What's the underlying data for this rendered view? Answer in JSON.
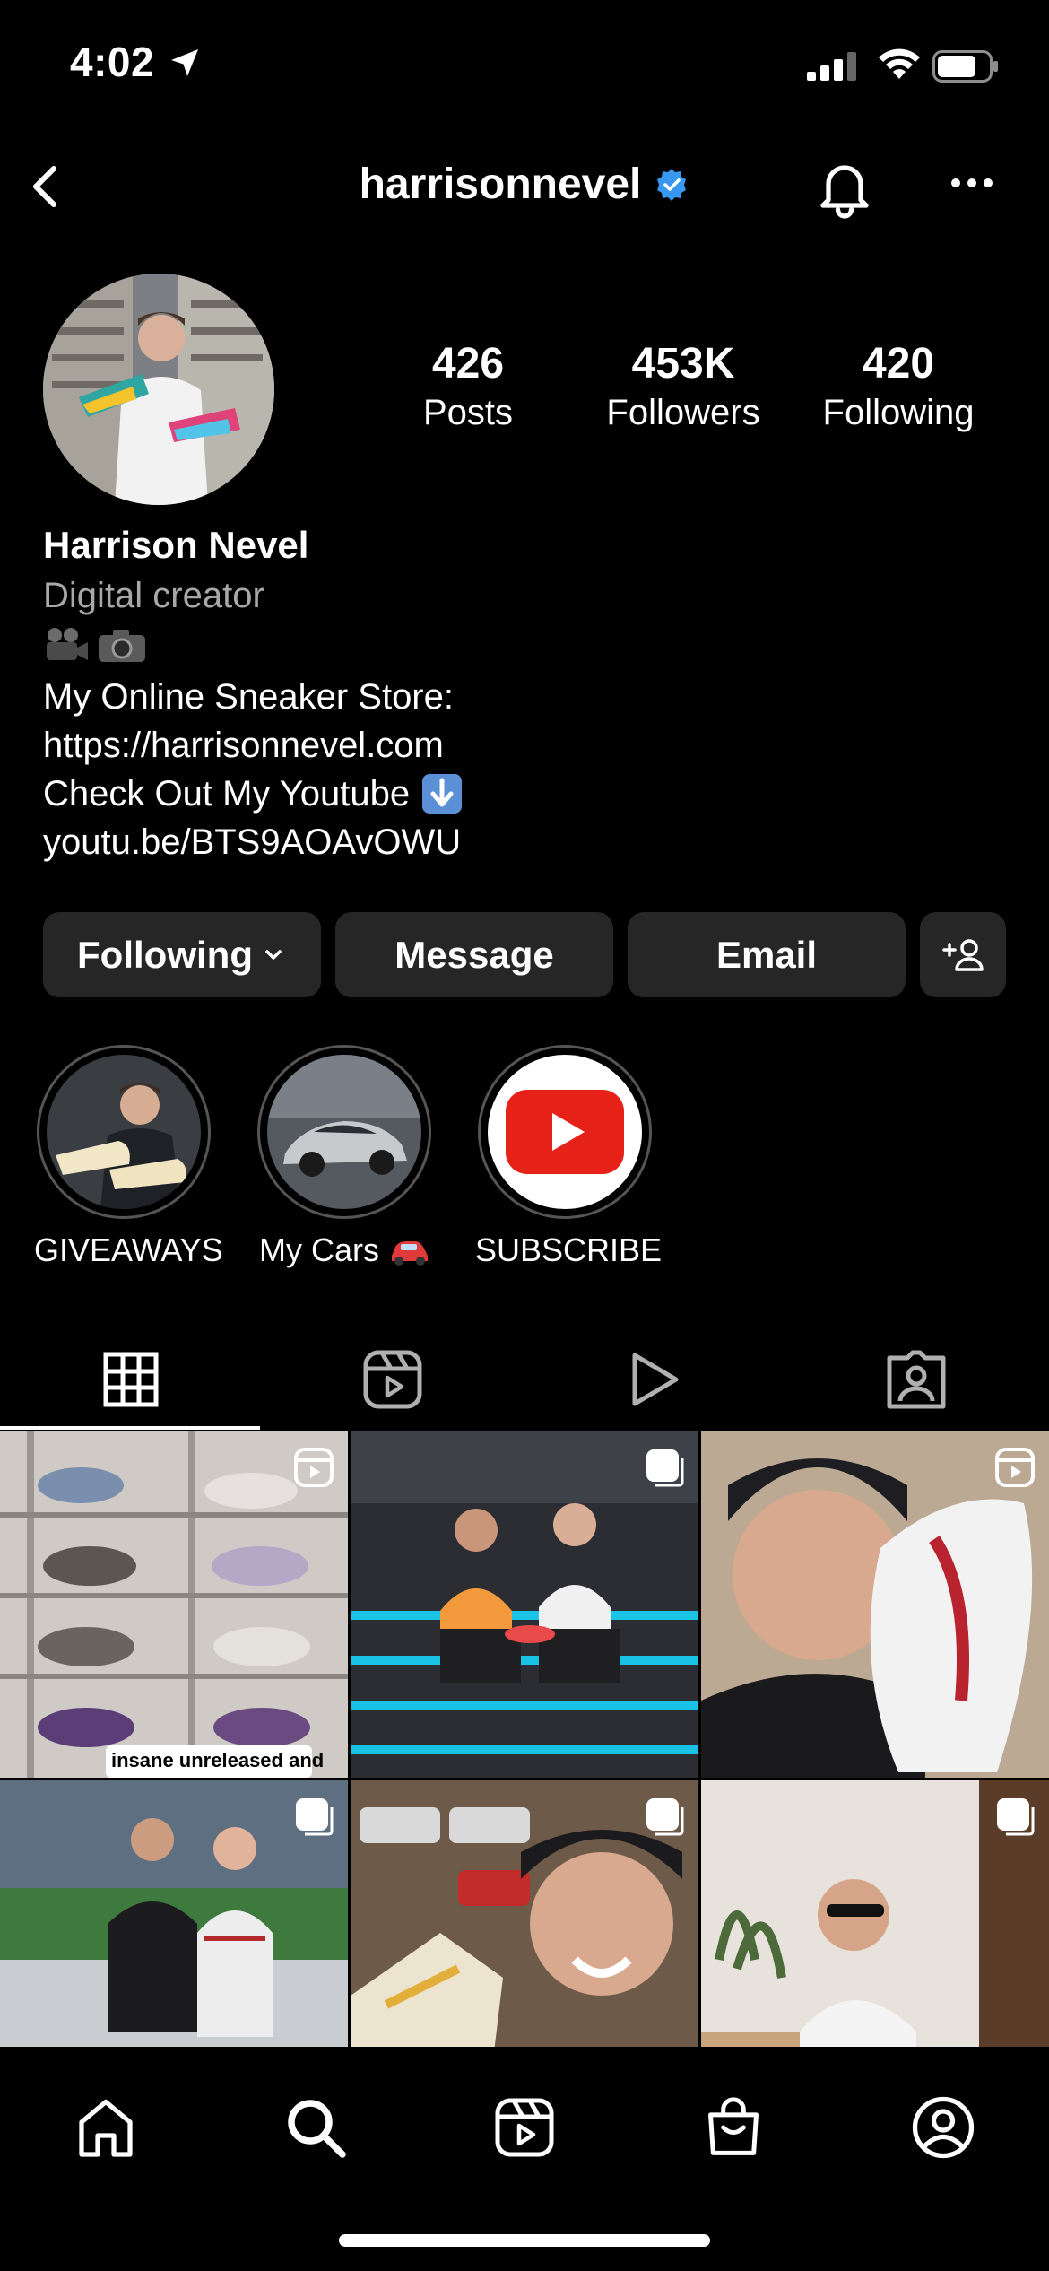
{
  "status_bar": {
    "time": "4:02"
  },
  "header": {
    "username": "harrisonnevel"
  },
  "profile": {
    "stats": [
      {
        "value": "426",
        "label": "Posts"
      },
      {
        "value": "453K",
        "label": "Followers"
      },
      {
        "value": "420",
        "label": "Following"
      }
    ],
    "name": "Harrison Nevel",
    "category": "Digital creator",
    "bio": {
      "line1": "My Online Sneaker Store:",
      "line2": "https://harrisonnevel.com",
      "line3": "Check Out My Youtube",
      "line4": "youtu.be/BTS9AOAvOWU"
    }
  },
  "actions": {
    "following_label": "Following",
    "message_label": "Message",
    "email_label": "Email"
  },
  "highlights": [
    {
      "label": "GIVEAWAYS"
    },
    {
      "label": "My Cars"
    },
    {
      "label": "SUBSCRIBE"
    }
  ],
  "grid": {
    "overlay_text": "insane unreleased and"
  },
  "colors": {
    "background": "#000000",
    "button_bg": "#262626",
    "secondary_text": "#a8a8a8",
    "verified_blue": "#3897f0",
    "youtube_red": "#e62117"
  },
  "icons": {
    "header": [
      "back-chevron-icon",
      "verified-badge-icon",
      "bell-icon",
      "more-dots-icon"
    ],
    "tabs": [
      "grid-icon",
      "reels-icon",
      "play-icon",
      "tagged-icon"
    ],
    "nav": [
      "home-icon",
      "search-icon",
      "reels-icon",
      "shop-icon",
      "profile-icon"
    ]
  }
}
